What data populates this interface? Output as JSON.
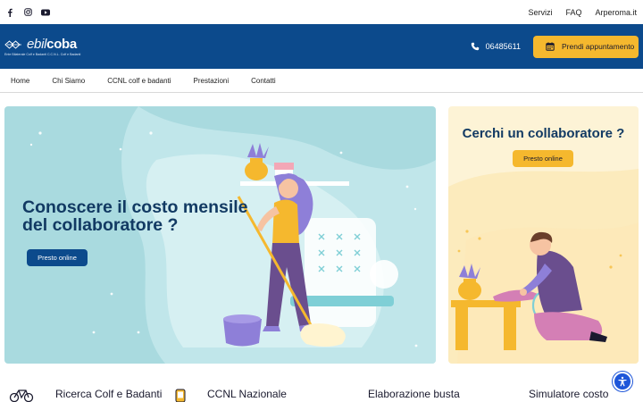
{
  "topbar": {
    "social": [
      "facebook-icon",
      "instagram-icon",
      "youtube-icon"
    ],
    "links": [
      "Servizi",
      "FAQ",
      "Arperoma.it"
    ]
  },
  "header": {
    "logo_prefix": "ebil",
    "logo_main": "coba",
    "logo_sub": "Ente Bilaterale Colf e Badanti C.C.N.L. Colf e Badanti",
    "phone": "06485611",
    "appointment_label": "Prendi appuntamento"
  },
  "nav": {
    "items": [
      "Home",
      "Chi Siamo",
      "CCNL colf e badanti",
      "Prestazioni",
      "Contatti"
    ]
  },
  "hero_left": {
    "title": "Conoscere il costo mensile del collaboratore ?",
    "button": "Presto online"
  },
  "hero_right": {
    "title": "Cerchi un collaboratore ?",
    "button": "Presto online"
  },
  "features": [
    {
      "title": "Ricerca Colf e Badanti",
      "icon": "bicycle-icon"
    },
    {
      "title": "CCNL Nazionale",
      "icon": "phone-icon"
    },
    {
      "title": "Elaborazione busta",
      "icon": ""
    },
    {
      "title": "Simulatore costo",
      "icon": ""
    }
  ],
  "colors": {
    "brand_blue": "#0c4a8c",
    "accent_yellow": "#f5b82e",
    "hero_left_bg": "#a9dadf",
    "hero_right_bg": "#fdf3d6",
    "title_navy": "#123a63"
  }
}
